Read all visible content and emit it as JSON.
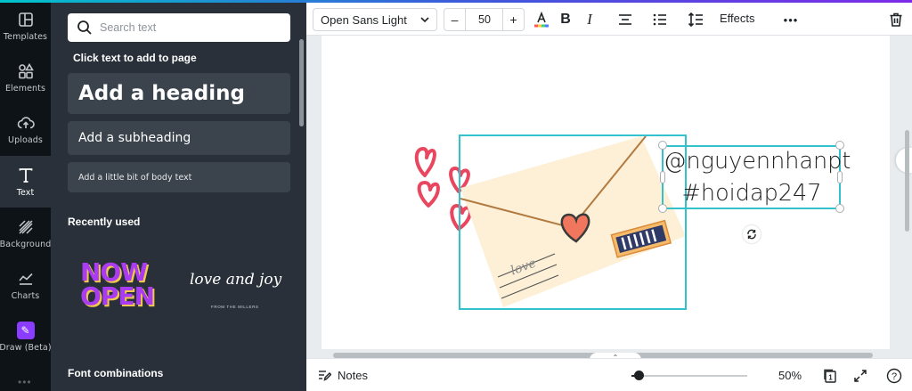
{
  "rail": {
    "items": [
      {
        "label": "Templates"
      },
      {
        "label": "Elements"
      },
      {
        "label": "Uploads"
      },
      {
        "label": "Text"
      },
      {
        "label": "Background"
      },
      {
        "label": "Charts"
      },
      {
        "label": "Draw (Beta)"
      }
    ],
    "more": "•••"
  },
  "panel": {
    "search_placeholder": "Search text",
    "click_hint": "Click text to add to page",
    "add_heading": "Add a heading",
    "add_subheading": "Add a subheading",
    "add_body": "Add a little bit of body text",
    "recently_used": "Recently used",
    "recent_cards": [
      {
        "line1": "NOW",
        "line2": "OPEN"
      },
      {
        "title": "love and joy",
        "subtitle": "FROM THE MILLERS"
      }
    ],
    "font_combinations": "Font combinations"
  },
  "toolbar": {
    "font": "Open Sans Light",
    "size_minus": "–",
    "size": "50",
    "size_plus": "+",
    "bold": "B",
    "italic": "I",
    "effects": "Effects",
    "more": "•••"
  },
  "canvas": {
    "text_line1": "@nguyennhanpt",
    "text_line2": "#hoidap247",
    "stamp_word": "love"
  },
  "bottombar": {
    "notes": "Notes",
    "zoom": "50%",
    "page_number": "1",
    "help": "?",
    "zoom_level": 0.05
  },
  "colors": {
    "accent": "#33c2cc",
    "panel_bg": "#293039",
    "rail_bg": "#0e1318",
    "draw_badge": "#8b3dff",
    "heart": "#e8475f"
  }
}
